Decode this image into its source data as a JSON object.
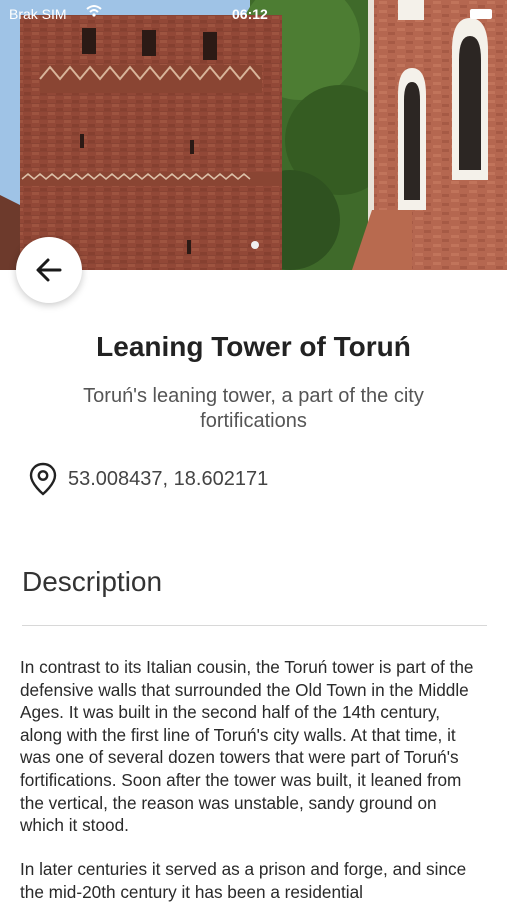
{
  "status_bar": {
    "carrier": "Brak SIM",
    "time": "06:12"
  },
  "place": {
    "title": "Leaning Tower of Toruń",
    "subtitle": "Toruń's leaning tower, a part of the city fortifications",
    "coordinates": "53.008437, 18.602171"
  },
  "description": {
    "heading": "Description",
    "paragraph_1": "In contrast to its Italian cousin, the Toruń tower is part of the defensive walls that surrounded the Old Town in the Middle Ages. It was built in the second half of the 14th century, along with the first line of Toruń's city walls. At that time, it was one of several dozen towers that were part of Toruń's fortifications. Soon after the tower was built, it leaned from the vertical, the reason was unstable, sandy ground on which it stood.",
    "paragraph_2": "In later centuries it served as a prison and forge, and since the mid-20th century it has been a residential"
  },
  "icons": {
    "back": "arrow-left-icon",
    "location": "map-pin-icon",
    "wifi": "wifi-icon",
    "battery": "battery-icon"
  },
  "colors": {
    "brick": "#a5523f",
    "text_primary": "#222222",
    "text_secondary": "#555555"
  }
}
